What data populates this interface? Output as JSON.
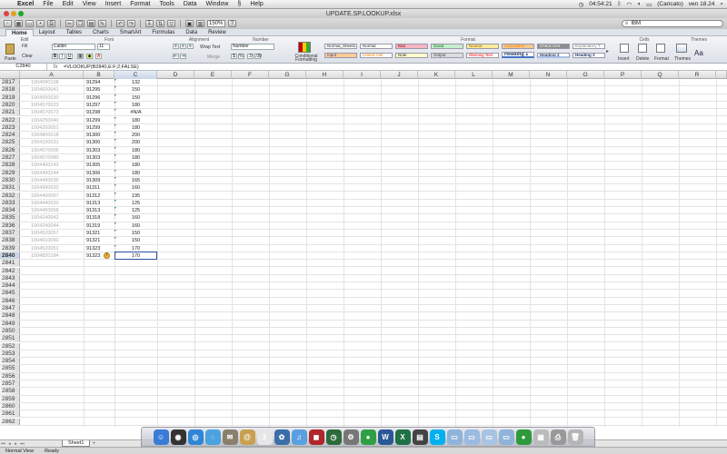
{
  "menubar": {
    "app": "Excel",
    "items": [
      "File",
      "Edit",
      "View",
      "Insert",
      "Format",
      "Tools",
      "Data",
      "Window",
      "Help"
    ],
    "clock": "04:54:21",
    "user": "(Caricato)",
    "datetime": "ven 18.24"
  },
  "window": {
    "title": "UPDATE.SP.LOOKUP.xlsx"
  },
  "toolbar": {
    "zoom": "150%",
    "search": "IBM"
  },
  "ribbon_tabs": [
    "Home",
    "Layout",
    "Tables",
    "Charts",
    "SmartArt",
    "Formulas",
    "Data",
    "Review"
  ],
  "ribbon": {
    "groups": {
      "edit": "Edit",
      "font": "Font",
      "alignment": "Alignment",
      "number": "Number",
      "format": "Format",
      "cells": "Cells",
      "themes": "Themes"
    },
    "paste": "Paste",
    "fill": "Fill",
    "clear": "Clear",
    "font_name": "Calibri",
    "font_size": "11",
    "wrap_text": "Wrap Text",
    "merge": "Merge",
    "number_format": "Number",
    "conditional_formatting": "Conditional Formatting",
    "styles": [
      {
        "label": "Normal_Sheet1",
        "bg": "#ffffff",
        "fg": "#222222"
      },
      {
        "label": "Normal",
        "bg": "#ffffff",
        "fg": "#222222"
      },
      {
        "label": "Bad",
        "bg": "#f4b6c2",
        "fg": "#9c0006"
      },
      {
        "label": "Good",
        "bg": "#c6efce",
        "fg": "#006100"
      },
      {
        "label": "Neutral",
        "bg": "#ffeb9c",
        "fg": "#9c6500"
      },
      {
        "label": "Calculation",
        "bg": "#f2c98f",
        "fg": "#fa7d00"
      },
      {
        "label": "Check Cell",
        "bg": "#8c8c8c",
        "fg": "#ffffff"
      },
      {
        "label": "Explanatory T...",
        "bg": "#ffffff",
        "fg": "#7f7f7f"
      },
      {
        "label": "Input",
        "bg": "#ffcc99",
        "fg": "#3f3f76"
      },
      {
        "label": "Linked Cell",
        "bg": "#ffffff",
        "fg": "#fa7d00"
      },
      {
        "label": "Note",
        "bg": "#ffffcc",
        "fg": "#222222"
      },
      {
        "label": "Output",
        "bg": "#dddddd",
        "fg": "#3f3f3f"
      },
      {
        "label": "Warning Text",
        "bg": "#ffffff",
        "fg": "#ff0000"
      },
      {
        "label": "Heading 1",
        "bg": "#ffffff",
        "fg": "#1f3864"
      },
      {
        "label": "Heading 2",
        "bg": "#ffffff",
        "fg": "#1f3864"
      },
      {
        "label": "Heading 3",
        "bg": "#ffffff",
        "fg": "#1f3864"
      }
    ],
    "cells_buttons": [
      "Insert",
      "Delete",
      "Format"
    ],
    "themes_buttons": [
      "Themes",
      "Aa"
    ]
  },
  "formula_bar": {
    "name_box": "C2840",
    "fx": "fx",
    "formula": "=VLOOKUP(B2840,E:F;2;FALSE)"
  },
  "columns": [
    "A",
    "B",
    "C",
    "D",
    "E",
    "F",
    "G",
    "H",
    "I",
    "J",
    "K",
    "L",
    "M",
    "N",
    "O",
    "P",
    "Q",
    "R"
  ],
  "rows": [
    {
      "n": "2817",
      "a": "1004680108",
      "b": "91294",
      "c": "132"
    },
    {
      "n": "2818",
      "a": "1004600041",
      "b": "91295",
      "c": "150"
    },
    {
      "n": "2819",
      "a": "1004550030",
      "b": "91296",
      "c": "150"
    },
    {
      "n": "2820",
      "a": "1004570023",
      "b": "91297",
      "c": "180"
    },
    {
      "n": "2821",
      "a": "1004570073",
      "b": "91298",
      "c": "#N/A"
    },
    {
      "n": "2822",
      "a": "1004250040",
      "b": "91299",
      "c": "180"
    },
    {
      "n": "2823",
      "a": "1004260051",
      "b": "91299",
      "c": "180"
    },
    {
      "n": "2824",
      "a": "1004800018",
      "b": "91300",
      "c": "200"
    },
    {
      "n": "2825",
      "a": "1004100031",
      "b": "91300",
      "c": "200"
    },
    {
      "n": "2826",
      "a": "1004570006",
      "b": "91303",
      "c": "180"
    },
    {
      "n": "2827",
      "a": "1004570080",
      "b": "91303",
      "c": "180"
    },
    {
      "n": "2828",
      "a": "1004400243",
      "b": "91305",
      "c": "180"
    },
    {
      "n": "2829",
      "a": "1004400244",
      "b": "91306",
      "c": "180"
    },
    {
      "n": "2830",
      "a": "1004490035",
      "b": "91309",
      "c": "165"
    },
    {
      "n": "2831",
      "a": "1004990020",
      "b": "91311",
      "c": "160"
    },
    {
      "n": "2832",
      "a": "1004400067",
      "b": "91312",
      "c": "195"
    },
    {
      "n": "2833",
      "a": "1004440020",
      "b": "91313",
      "c": "125"
    },
    {
      "n": "2834",
      "a": "1004450058",
      "b": "91313",
      "c": "125"
    },
    {
      "n": "2835",
      "a": "1004240042",
      "b": "91318",
      "c": "160"
    },
    {
      "n": "2836",
      "a": "1004240044",
      "b": "91319",
      "c": "160"
    },
    {
      "n": "2837",
      "a": "1004520057",
      "b": "91321",
      "c": "150"
    },
    {
      "n": "2838",
      "a": "1004610090",
      "b": "91321",
      "c": "150"
    },
    {
      "n": "2839",
      "a": "1004520051",
      "b": "91323",
      "c": "170"
    },
    {
      "n": "2840",
      "a": "1004820184",
      "b": "91323",
      "c": "170"
    },
    {
      "n": "2841",
      "a": "",
      "b": "",
      "c": ""
    },
    {
      "n": "2842",
      "a": "",
      "b": "",
      "c": ""
    },
    {
      "n": "2843",
      "a": "",
      "b": "",
      "c": ""
    },
    {
      "n": "2844",
      "a": "",
      "b": "",
      "c": ""
    },
    {
      "n": "2845",
      "a": "",
      "b": "",
      "c": ""
    },
    {
      "n": "2846",
      "a": "",
      "b": "",
      "c": ""
    },
    {
      "n": "2847",
      "a": "",
      "b": "",
      "c": ""
    },
    {
      "n": "2848",
      "a": "",
      "b": "",
      "c": ""
    },
    {
      "n": "2849",
      "a": "",
      "b": "",
      "c": ""
    },
    {
      "n": "2850",
      "a": "",
      "b": "",
      "c": ""
    },
    {
      "n": "2851",
      "a": "",
      "b": "",
      "c": ""
    },
    {
      "n": "2852",
      "a": "",
      "b": "",
      "c": ""
    },
    {
      "n": "2853",
      "a": "",
      "b": "",
      "c": ""
    },
    {
      "n": "2854",
      "a": "",
      "b": "",
      "c": ""
    },
    {
      "n": "2855",
      "a": "",
      "b": "",
      "c": ""
    },
    {
      "n": "2856",
      "a": "",
      "b": "",
      "c": ""
    },
    {
      "n": "2857",
      "a": "",
      "b": "",
      "c": ""
    },
    {
      "n": "2858",
      "a": "",
      "b": "",
      "c": ""
    },
    {
      "n": "2859",
      "a": "",
      "b": "",
      "c": ""
    },
    {
      "n": "2860",
      "a": "",
      "b": "",
      "c": ""
    },
    {
      "n": "2861",
      "a": "",
      "b": "",
      "c": ""
    },
    {
      "n": "2862",
      "a": "",
      "b": "",
      "c": ""
    }
  ],
  "selected_row": "2840",
  "selected_column": "C",
  "sheet_tab": "Sheet1",
  "status": {
    "view": "Normal View",
    "state": "Ready"
  },
  "dock_icons": [
    {
      "name": "finder-icon",
      "color": "#3a7bd5",
      "glyph": "☺"
    },
    {
      "name": "dashboard-icon",
      "color": "#333333",
      "glyph": "◉"
    },
    {
      "name": "safari-icon",
      "color": "#2f86d6",
      "glyph": "◎"
    },
    {
      "name": "ichat-icon",
      "color": "#4aa3df",
      "glyph": "◌"
    },
    {
      "name": "mail-icon",
      "color": "#8a7f6a",
      "glyph": "✉"
    },
    {
      "name": "address-book-icon",
      "color": "#c8a04f",
      "glyph": "@"
    },
    {
      "name": "ical-icon",
      "color": "#e6e6e6",
      "glyph": "3"
    },
    {
      "name": "iphoto-icon",
      "color": "#3b6ea8",
      "glyph": "✿"
    },
    {
      "name": "itunes-icon",
      "color": "#5aa0e0",
      "glyph": "♫"
    },
    {
      "name": "photobooth-icon",
      "color": "#b0262a",
      "glyph": "◼"
    },
    {
      "name": "time-machine-icon",
      "color": "#2d6b3a",
      "glyph": "◷"
    },
    {
      "name": "system-prefs-icon",
      "color": "#777777",
      "glyph": "⚙"
    },
    {
      "name": "app-store-icon",
      "color": "#2ea043",
      "glyph": "●"
    },
    {
      "name": "word-icon",
      "color": "#2b5797",
      "glyph": "W"
    },
    {
      "name": "excel-icon",
      "color": "#1e7145",
      "glyph": "X"
    },
    {
      "name": "powerpoint-icon",
      "color": "#444444",
      "glyph": "▤"
    },
    {
      "name": "skype-icon",
      "color": "#00aff0",
      "glyph": "S"
    },
    {
      "name": "folder-icon",
      "color": "#8fb3d9",
      "glyph": "▭"
    },
    {
      "name": "downloads-icon",
      "color": "#9bbbe0",
      "glyph": "▭"
    },
    {
      "name": "documents-icon",
      "color": "#a8c3e3",
      "glyph": "▭"
    },
    {
      "name": "applications-icon",
      "color": "#8fb3d9",
      "glyph": "▭"
    },
    {
      "name": "messenger-icon",
      "color": "#2e9a3b",
      "glyph": "●"
    },
    {
      "name": "stack-icon",
      "color": "#bbbbbb",
      "glyph": "▦"
    },
    {
      "name": "printer-icon",
      "color": "#999999",
      "glyph": "⎙"
    },
    {
      "name": "trash-icon",
      "color": "#b5b5b5",
      "glyph": "🗑"
    }
  ]
}
